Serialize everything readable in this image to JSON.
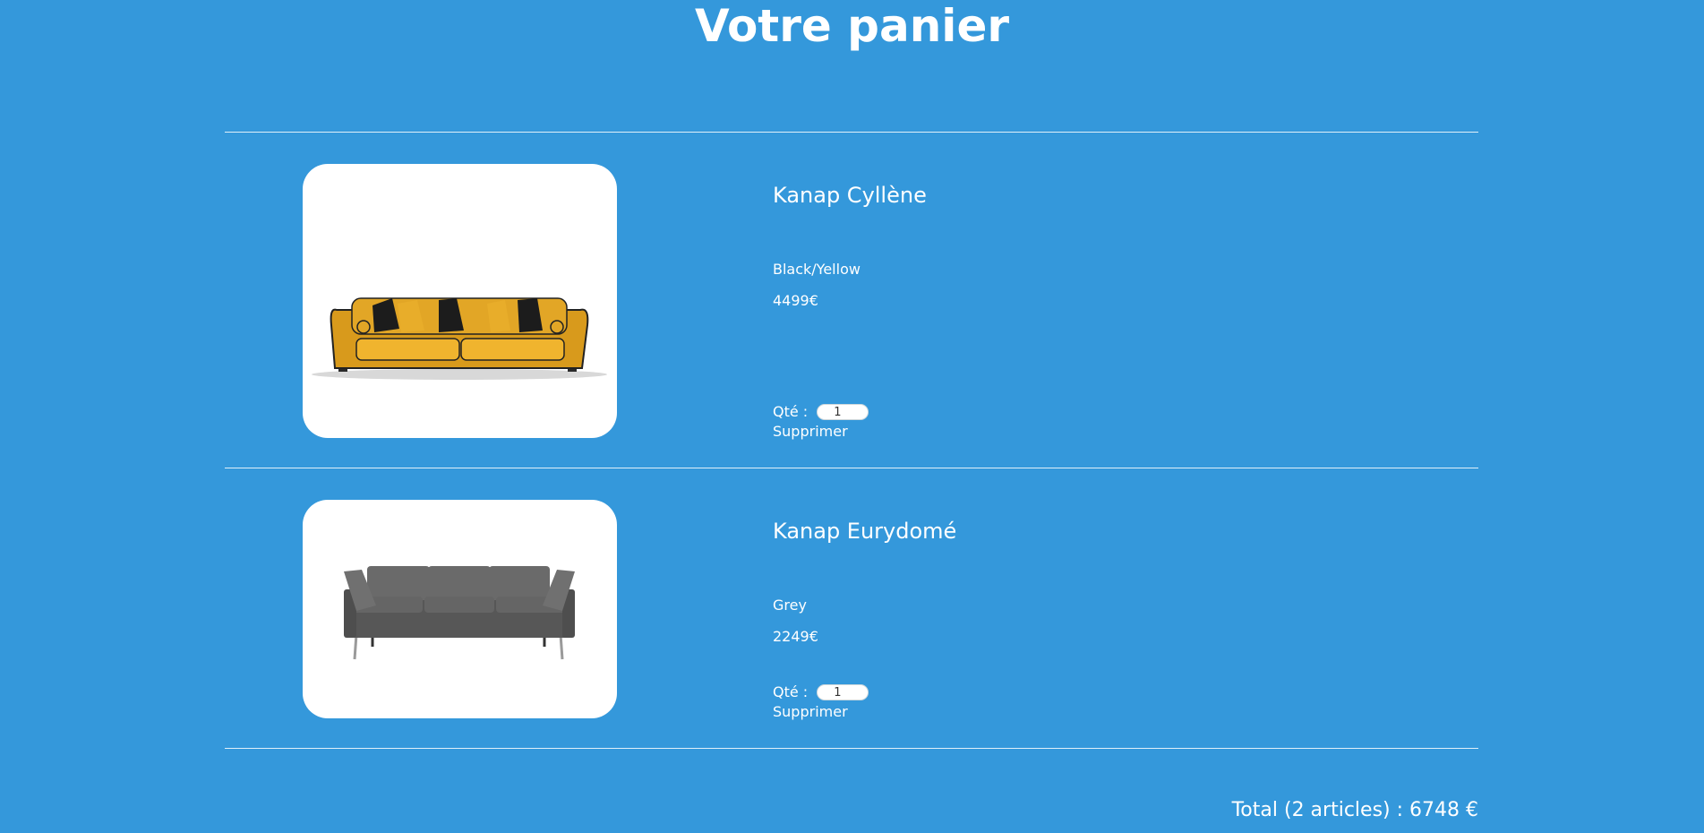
{
  "page": {
    "title": "Votre panier"
  },
  "cart": {
    "items": [
      {
        "name": "Kanap Cyllène",
        "color": "Black/Yellow",
        "price": "4499€",
        "qty_label": "Qté :",
        "qty_value": "1",
        "delete_label": "Supprimer",
        "image_icon": "yellow-sofa-image"
      },
      {
        "name": "Kanap Eurydomé",
        "color": "Grey",
        "price": "2249€",
        "qty_label": "Qté :",
        "qty_value": "1",
        "delete_label": "Supprimer",
        "image_icon": "grey-sofa-image"
      }
    ],
    "total_text": "Total (2 articles) : 6748 €"
  },
  "colors": {
    "background": "#3498db",
    "text": "#ffffff",
    "card": "#ffffff"
  }
}
